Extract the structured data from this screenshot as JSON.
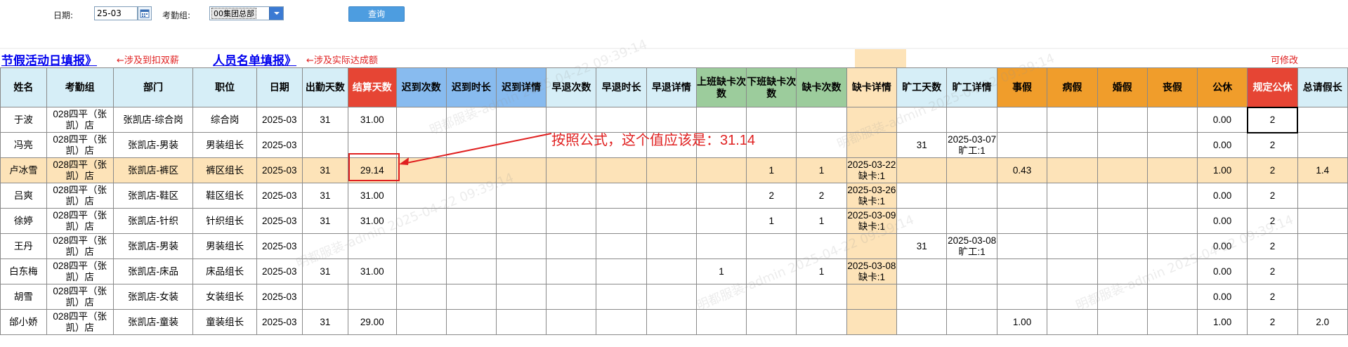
{
  "filters": {
    "date_label": "日期:",
    "date_value": "25-03",
    "group_label": "考勤组:",
    "group_value": "00集团总部",
    "query_label": "查询"
  },
  "links": {
    "holiday_fill": "节假活动日填报》",
    "holiday_note": "←涉及到扣双薪",
    "staff_fill": "人员名单填报》",
    "staff_note": "←涉及实际达成额",
    "editable": "可修改"
  },
  "annotation": {
    "callout": "按照公式，这个值应该是：31.14"
  },
  "watermark": "明都服装-admin 2025-04-22 09:39:14",
  "columns": [
    "姓名",
    "考勤组",
    "部门",
    "职位",
    "日期",
    "出勤天数",
    "结算天数",
    "迟到次数",
    "迟到时长",
    "迟到详情",
    "早退次数",
    "早退时长",
    "早退详情",
    "上班缺卡次数",
    "下班缺卡次数",
    "缺卡次数",
    "缺卡详情",
    "旷工天数",
    "旷工详情",
    "事假",
    "病假",
    "婚假",
    "丧假",
    "公休",
    "规定公休",
    "总请假长"
  ],
  "rows": [
    [
      "于波",
      "028四平（张凯）店",
      "张凯店-综合岗",
      "综合岗",
      "2025-03",
      "31",
      "31.00",
      "",
      "",
      "",
      "",
      "",
      "",
      "",
      "",
      "",
      "",
      "",
      "",
      "",
      "",
      "",
      "",
      "0.00",
      "2",
      ""
    ],
    [
      "冯亮",
      "028四平（张凯）店",
      "张凯店-男装",
      "男装组长",
      "2025-03",
      "",
      "",
      "",
      "",
      "",
      "",
      "",
      "",
      "",
      "",
      "",
      "",
      "31",
      "2025-03-07 旷工:1",
      "",
      "",
      "",
      "",
      "0.00",
      "2",
      ""
    ],
    [
      "卢冰雪",
      "028四平（张凯）店",
      "张凯店-裤区",
      "裤区组长",
      "2025-03",
      "31",
      "29.14",
      "",
      "",
      "",
      "",
      "",
      "",
      "",
      "1",
      "1",
      "2025-03-22 缺卡:1",
      "",
      "",
      "0.43",
      "",
      "",
      "",
      "1.00",
      "2",
      "1.4"
    ],
    [
      "吕爽",
      "028四平（张凯）店",
      "张凯店-鞋区",
      "鞋区组长",
      "2025-03",
      "31",
      "31.00",
      "",
      "",
      "",
      "",
      "",
      "",
      "",
      "2",
      "2",
      "2025-03-26 缺卡:1",
      "",
      "",
      "",
      "",
      "",
      "",
      "0.00",
      "2",
      ""
    ],
    [
      "徐婷",
      "028四平（张凯）店",
      "张凯店-针织",
      "针织组长",
      "2025-03",
      "31",
      "31.00",
      "",
      "",
      "",
      "",
      "",
      "",
      "",
      "1",
      "1",
      "2025-03-09 缺卡:1",
      "",
      "",
      "",
      "",
      "",
      "",
      "0.00",
      "2",
      ""
    ],
    [
      "王丹",
      "028四平（张凯）店",
      "张凯店-男装",
      "男装组长",
      "2025-03",
      "",
      "",
      "",
      "",
      "",
      "",
      "",
      "",
      "",
      "",
      "",
      "",
      "31",
      "2025-03-08 旷工:1",
      "",
      "",
      "",
      "",
      "0.00",
      "2",
      ""
    ],
    [
      "白东梅",
      "028四平（张凯）店",
      "张凯店-床品",
      "床品组长",
      "2025-03",
      "31",
      "31.00",
      "",
      "",
      "",
      "",
      "",
      "",
      "1",
      "",
      "1",
      "2025-03-08 缺卡:1",
      "",
      "",
      "",
      "",
      "",
      "",
      "0.00",
      "2",
      ""
    ],
    [
      "胡雪",
      "028四平（张凯）店",
      "张凯店-女装",
      "女装组长",
      "2025-03",
      "",
      "",
      "",
      "",
      "",
      "",
      "",
      "",
      "",
      "",
      "",
      "",
      "",
      "",
      "",
      "",
      "",
      "",
      "0.00",
      "2",
      ""
    ],
    [
      "邰小娇",
      "028四平（张凯）店",
      "张凯店-童装",
      "童装组长",
      "2025-03",
      "31",
      "29.00",
      "",
      "",
      "",
      "",
      "",
      "",
      "",
      "",
      "",
      "",
      "",
      "",
      "1.00",
      "",
      "",
      "",
      "1.00",
      "2",
      "2.0"
    ]
  ],
  "colors": {
    "header_light_blue": "#d6eef7",
    "header_red": "#e64534",
    "header_blue": "#88bbef",
    "header_green": "#9ccc9c",
    "header_tan": "#fde3b8",
    "header_orange": "#f09d2b",
    "annotation_red": "#e02020"
  },
  "icons": {
    "calendar": "calendar-icon",
    "dropdown": "chevron-down-icon"
  }
}
